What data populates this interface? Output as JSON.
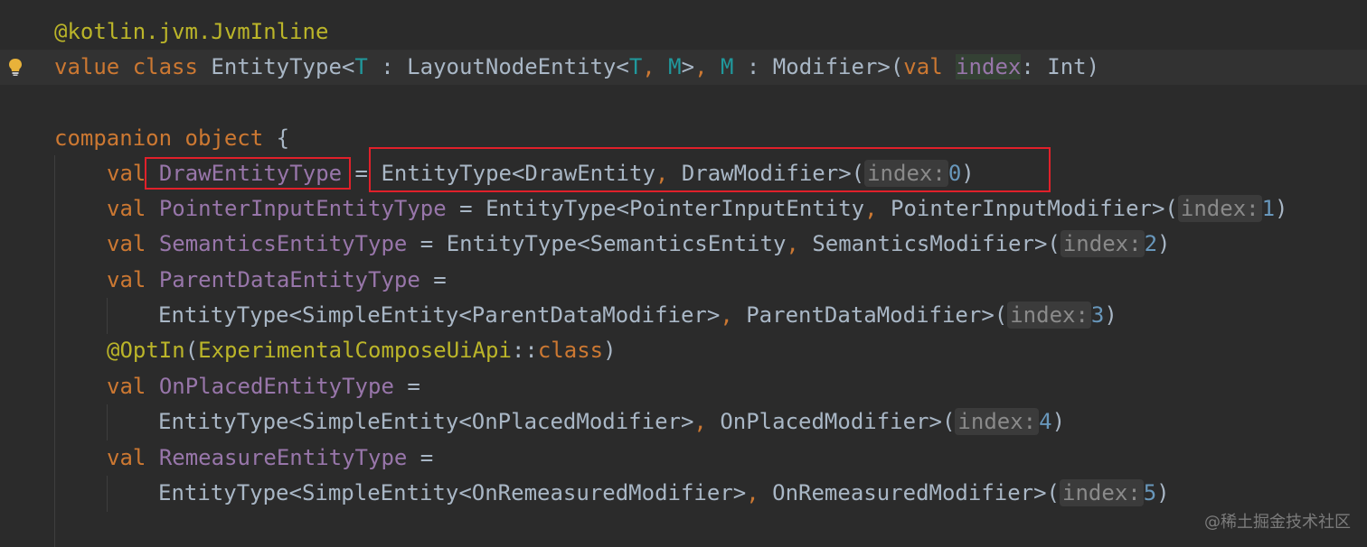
{
  "editor": {
    "lines": [
      {
        "annotation": "@kotlin.jvm.JvmInline"
      },
      {
        "kw_value": "value",
        "kw_class": "class",
        "class_name": "EntityType",
        "lt": "<",
        "tp_T": "T",
        "colon1": " : ",
        "bound": "LayoutNodeEntity",
        "lt2": "<",
        "tp_T2": "T",
        "comma": ", ",
        "tp_M": "M",
        "gt": ">",
        "comma2": ", ",
        "tp_M2": "M",
        "colon2": " : ",
        "bound2": "Modifier",
        "gt2": ">(",
        "kw_val": "val",
        "param": "index",
        "colon3": ": ",
        "type": "Int",
        "close": ")"
      },
      {
        "kw_companion": "companion",
        "kw_object": "object",
        "brace": " {"
      },
      {
        "kw_val": "val",
        "name": "DrawEntityType",
        "eq": " = ",
        "call": "EntityType<DrawEntity",
        "comma": ", ",
        "call2": "DrawModifier>(",
        "hint": "index:",
        "value": "0",
        "close": ")"
      },
      {
        "kw_val": "val",
        "name": "PointerInputEntityType",
        "eq": " = ",
        "call": "EntityType<PointerInputEntity",
        "comma": ", ",
        "call2": "PointerInputModifier>(",
        "hint": "index:",
        "value": "1",
        "close": ")"
      },
      {
        "kw_val": "val",
        "name": "SemanticsEntityType",
        "eq": " = ",
        "call": "EntityType<SemanticsEntity",
        "comma": ", ",
        "call2": "SemanticsModifier>(",
        "hint": "index:",
        "value": "2",
        "close": ")"
      },
      {
        "kw_val": "val",
        "name": "ParentDataEntityType",
        "eq": " ="
      },
      {
        "call": "EntityType<SimpleEntity<ParentDataModifier>",
        "comma": ", ",
        "call2": "ParentDataModifier>(",
        "hint": "index:",
        "value": "3",
        "close": ")"
      },
      {
        "annotation": "@OptIn",
        "open": "(",
        "arg": "ExperimentalComposeUiApi",
        "sep": "::",
        "kw_class": "class",
        "close": ")"
      },
      {
        "kw_val": "val",
        "name": "OnPlacedEntityType",
        "eq": " ="
      },
      {
        "call": "EntityType<SimpleEntity<OnPlacedModifier>",
        "comma": ", ",
        "call2": "OnPlacedModifier>(",
        "hint": "index:",
        "value": "4",
        "close": ")"
      },
      {
        "kw_val": "val",
        "name": "RemeasureEntityType",
        "eq": " ="
      },
      {
        "call": "EntityType<SimpleEntity<OnRemeasuredModifier>",
        "comma": ", ",
        "call2": "OnRemeasuredModifier>(",
        "hint": "index:",
        "value": "5",
        "close": ")"
      }
    ]
  },
  "gutter": {
    "icon": "lightbulb-icon",
    "color": "#e8b23a"
  },
  "highlight": {
    "box_color": "#e0202a"
  },
  "watermark": "@稀土掘金技术社区"
}
